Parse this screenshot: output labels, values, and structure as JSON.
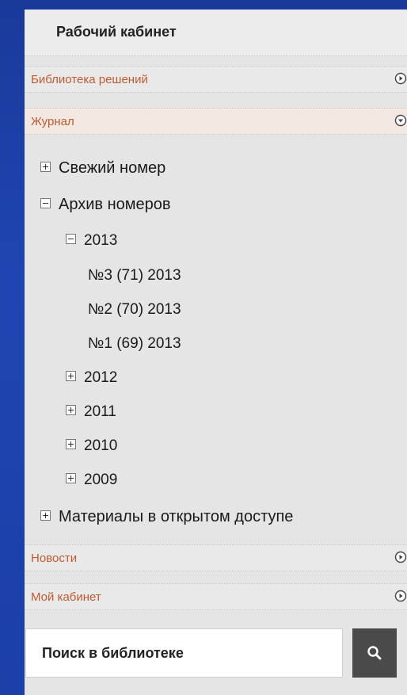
{
  "cabinet": {
    "title": "Рабочий кабинет"
  },
  "sections": [
    {
      "label": "Библиотека решений",
      "state": "collapsed",
      "icon": "arrow-right-circle-icon"
    },
    {
      "label": "Журнал",
      "state": "expanded",
      "icon": "arrow-down-circle-icon"
    },
    {
      "label": "Новости",
      "state": "collapsed",
      "icon": "arrow-right-circle-icon"
    },
    {
      "label": "Мой кабинет",
      "state": "collapsed",
      "icon": "arrow-right-circle-icon"
    }
  ],
  "journal_tree": {
    "fresh_issue": "Свежий номер",
    "archive": "Архив номеров",
    "year_2013": "2013",
    "issues_2013": [
      "№3 (71) 2013",
      "№2 (70) 2013",
      "№1 (69) 2013"
    ],
    "year_2012": "2012",
    "year_2011": "2011",
    "year_2010": "2010",
    "year_2009": "2009",
    "open_access": "Материалы в открытом доступе"
  },
  "search": {
    "placeholder": "Поиск в библиотеке",
    "button_icon": "search-icon"
  },
  "colors": {
    "background": "#1f45b2",
    "panel": "#e5e5e5",
    "section_label": "#bd5b32",
    "search_button": "#4a4a4a"
  }
}
